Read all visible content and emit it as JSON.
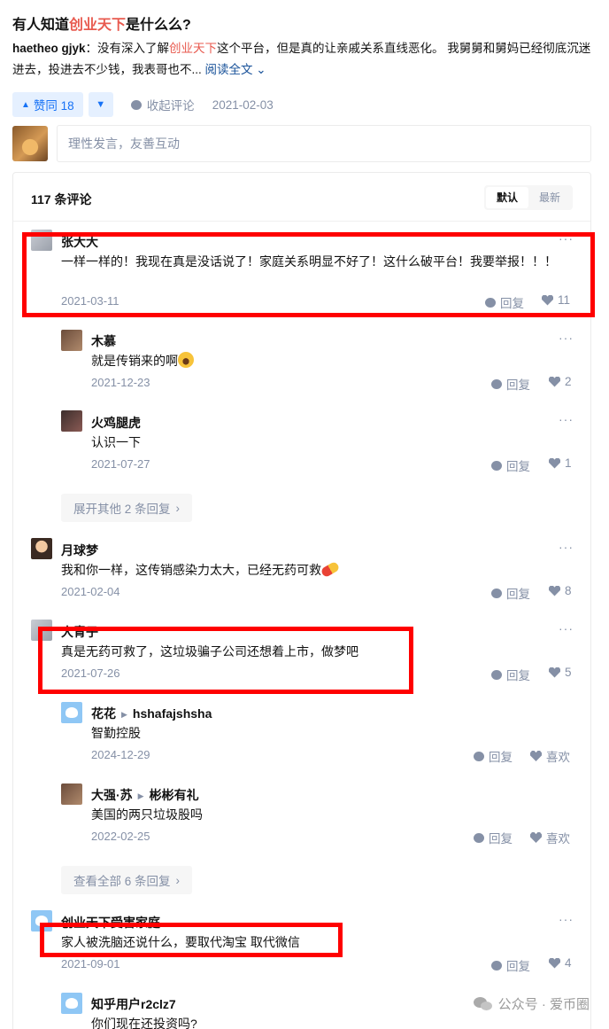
{
  "question": {
    "prefix": "有人知道",
    "keyword": "创业天下",
    "suffix": "是什么么?"
  },
  "answer": {
    "author": "haetheo gjyk",
    "text_before": "：没有深入了解",
    "keyword": "创业天下",
    "text_after": "这个平台，但是真的让亲戚关系直线恶化。 我舅舅和舅妈已经彻底沉迷进去，投进去不少钱，我表哥也不...",
    "read_more": "阅读全文",
    "date": "2021-02-03"
  },
  "actions": {
    "upvote": "赞同 18",
    "collapse": "收起评论"
  },
  "composer": {
    "placeholder": "理性发言，友善互动"
  },
  "comments_header": {
    "count": "117 条评论",
    "sort_default": "默认",
    "sort_latest": "最新"
  },
  "labels": {
    "reply": "回复",
    "like": "喜欢"
  },
  "comments": [
    {
      "name": "张大大",
      "text": "一样一样的！我现在真是没话说了！家庭关系明显不好了！这什么破平台！我要举报！！！",
      "date": "2021-03-11",
      "likes": "11"
    },
    {
      "name": "木慕",
      "text": "就是传销来的啊",
      "date": "2021-12-23",
      "likes": "2"
    },
    {
      "name": "火鸡腿虎",
      "text": "认识一下",
      "date": "2021-07-27",
      "likes": "1"
    },
    {
      "name": "月球梦",
      "text": "我和你一样，这传销感染力太大，已经无药可救",
      "date": "2021-02-04",
      "likes": "8"
    },
    {
      "name": "大青子",
      "text": "真是无药可救了，这垃圾骗子公司还想着上市，做梦吧",
      "date": "2021-07-26",
      "likes": "5"
    },
    {
      "name": "花花",
      "reply_to": "hshafajshsha",
      "text": "智勤控股",
      "date": "2024-12-29"
    },
    {
      "name": "大强·苏",
      "reply_to": "彬彬有礼",
      "text": "美国的两只垃圾股吗",
      "date": "2022-02-25"
    },
    {
      "name": "创业天下受害家庭",
      "text": "家人被洗脑还说什么，要取代淘宝 取代微信",
      "date": "2021-09-01",
      "likes": "4"
    },
    {
      "name": "知乎用户r2clz7",
      "text": "你们现在还投资吗?"
    }
  ],
  "expand_1": "展开其他 2 条回复",
  "expand_2": "查看全部 6 条回复",
  "watermark": "公众号 · 爱币圈"
}
